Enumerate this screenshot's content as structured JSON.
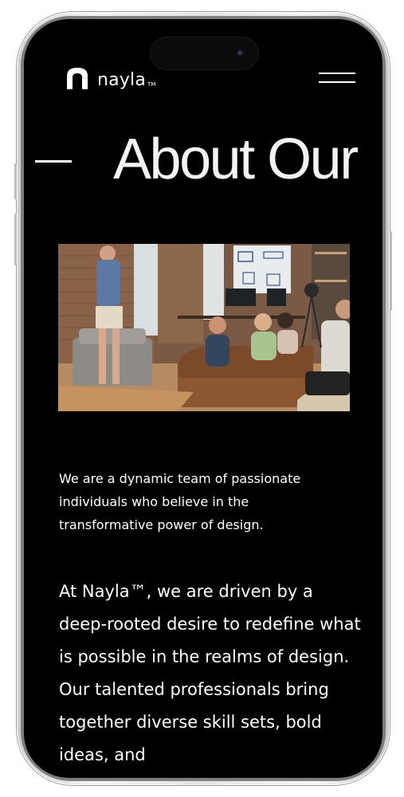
{
  "brand": {
    "name": "nayla",
    "trademark": "TM"
  },
  "nav": {
    "menu_icon": "hamburger-menu-icon"
  },
  "page": {
    "title": "About Our"
  },
  "hero_image": {
    "subject": "team-presentation-photo"
  },
  "content": {
    "intro": "We are a dynamic team of passionate individuals who believe in the transformative power of design.",
    "body": "At Nayla™, we are driven by a deep-rooted desire to redefine what is possible in the realms of design. Our talented professionals bring together diverse skill sets, bold ideas, and"
  },
  "colors": {
    "background": "#000000",
    "text": "#ffffff",
    "frame": "#e6e6e6"
  }
}
